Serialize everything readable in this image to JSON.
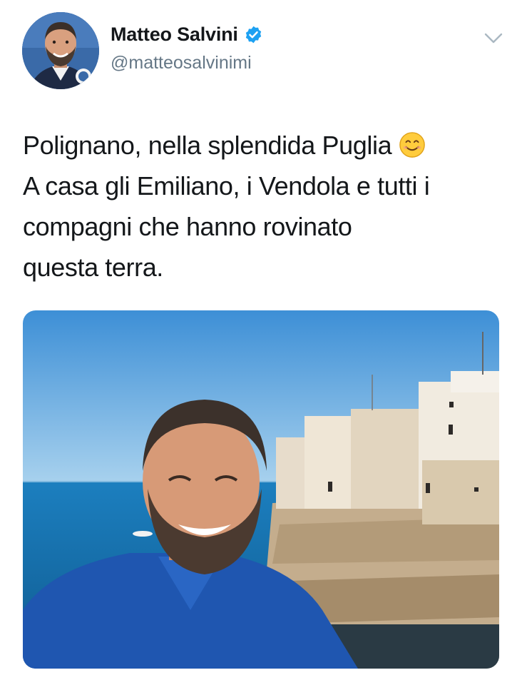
{
  "tweet": {
    "author": {
      "name": "Matteo Salvini",
      "handle": "@matteosalvinimi",
      "verified": true
    },
    "text_lines": [
      "Polignano, nella splendida Puglia",
      "A casa gli Emiliano, i Vendola e tutti i",
      "compagni che hanno rovinato",
      "questa terra."
    ],
    "emoji": "smiling-face-icon"
  },
  "colors": {
    "verified_badge": "#1da1f2",
    "handle_text": "#657786",
    "name_text": "#14171a"
  }
}
